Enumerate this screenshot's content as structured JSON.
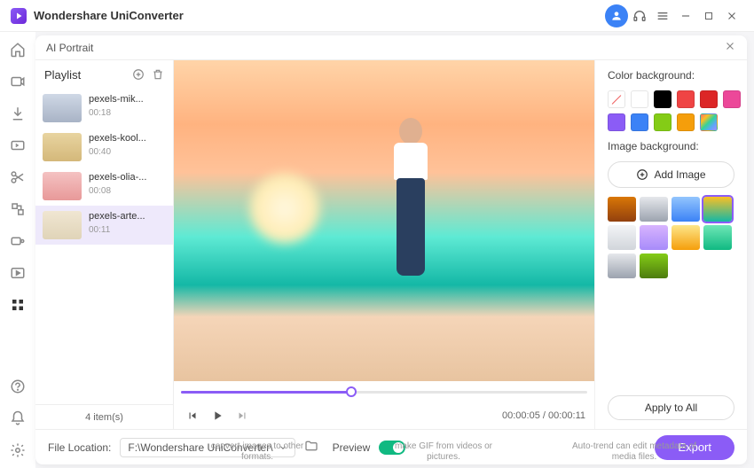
{
  "app": {
    "title": "Wondershare UniConverter"
  },
  "modal": {
    "title": "AI Portrait"
  },
  "playlist": {
    "header": "Playlist",
    "items": [
      {
        "name": "pexels-mik...",
        "dur": "00:18"
      },
      {
        "name": "pexels-kool...",
        "dur": "00:40"
      },
      {
        "name": "pexels-olia-...",
        "dur": "00:08"
      },
      {
        "name": "pexels-arte...",
        "dur": "00:11"
      }
    ],
    "count_label": "4 item(s)"
  },
  "controls": {
    "time": "00:00:05 / 00:00:11"
  },
  "right": {
    "color_label": "Color background:",
    "colors": [
      "none",
      "#ffffff",
      "#000000",
      "#ef4444",
      "#dc2626",
      "#ec4899",
      "#8b5cf6",
      "#3b82f6",
      "#84cc16",
      "#f59e0b",
      "rainbow"
    ],
    "image_label": "Image background:",
    "add_image": "Add Image",
    "apply_all": "Apply to All"
  },
  "bottom": {
    "file_loc_label": "File Location:",
    "file_loc_value": "F:\\Wondershare UniConverter\\",
    "preview_label": "Preview",
    "export": "Export"
  },
  "snippets": {
    "s1": "convert images to other formats.",
    "s2": "make GIF from videos or pictures.",
    "s3": "Auto-trend can edit metadata of media files."
  }
}
